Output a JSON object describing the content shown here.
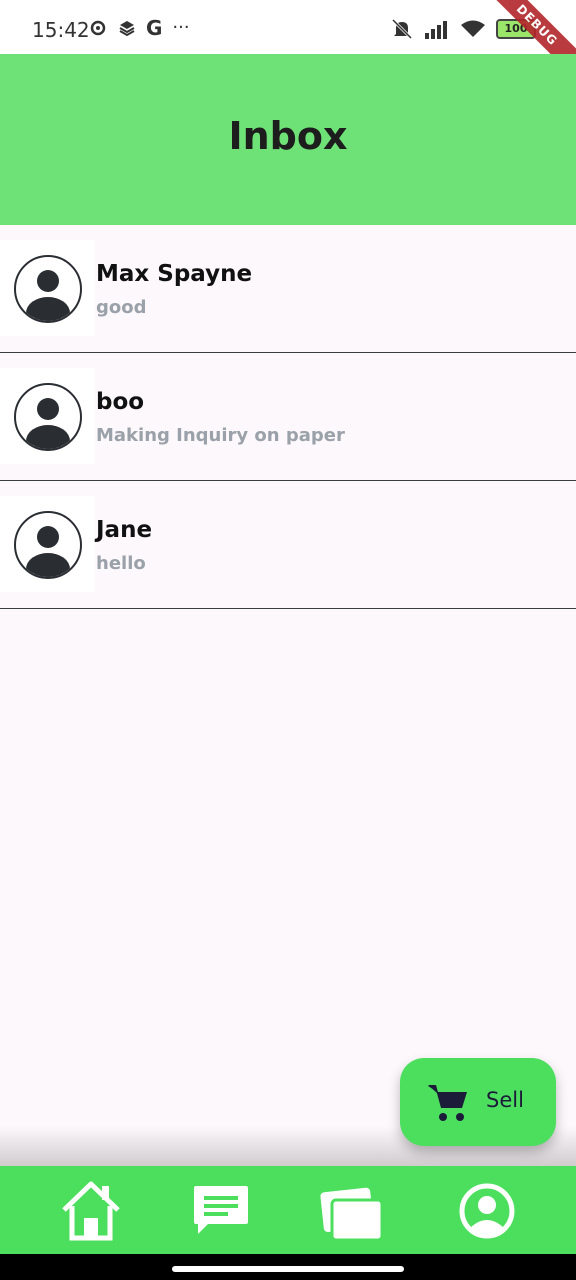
{
  "status_bar": {
    "time": "15:42",
    "left_icons": [
      "settings-icon",
      "layers-icon",
      "google-icon",
      "more-icon"
    ],
    "google_glyph": "G",
    "more_glyph": "···",
    "right_icons": [
      "mute-icon",
      "signal-icon",
      "wifi-icon",
      "battery-icon"
    ],
    "battery": "100",
    "debug_banner": "DEBUG"
  },
  "app_bar": {
    "title": "Inbox"
  },
  "conversations": [
    {
      "name": "Max Spayne",
      "message": "good"
    },
    {
      "name": "boo",
      "message": "Making Inquiry on paper"
    },
    {
      "name": "Jane",
      "message": "hello"
    }
  ],
  "fab": {
    "label": "Sell",
    "icon": "cart-icon"
  },
  "bottom_nav": {
    "items": [
      {
        "icon": "home-icon"
      },
      {
        "icon": "chat-icon"
      },
      {
        "icon": "cards-icon"
      },
      {
        "icon": "profile-icon"
      }
    ]
  },
  "colors": {
    "app_bar": "#6ee277",
    "nav_bar": "#4cdf5e",
    "background": "#fdf8fc",
    "message_text": "#9aa1a8"
  }
}
